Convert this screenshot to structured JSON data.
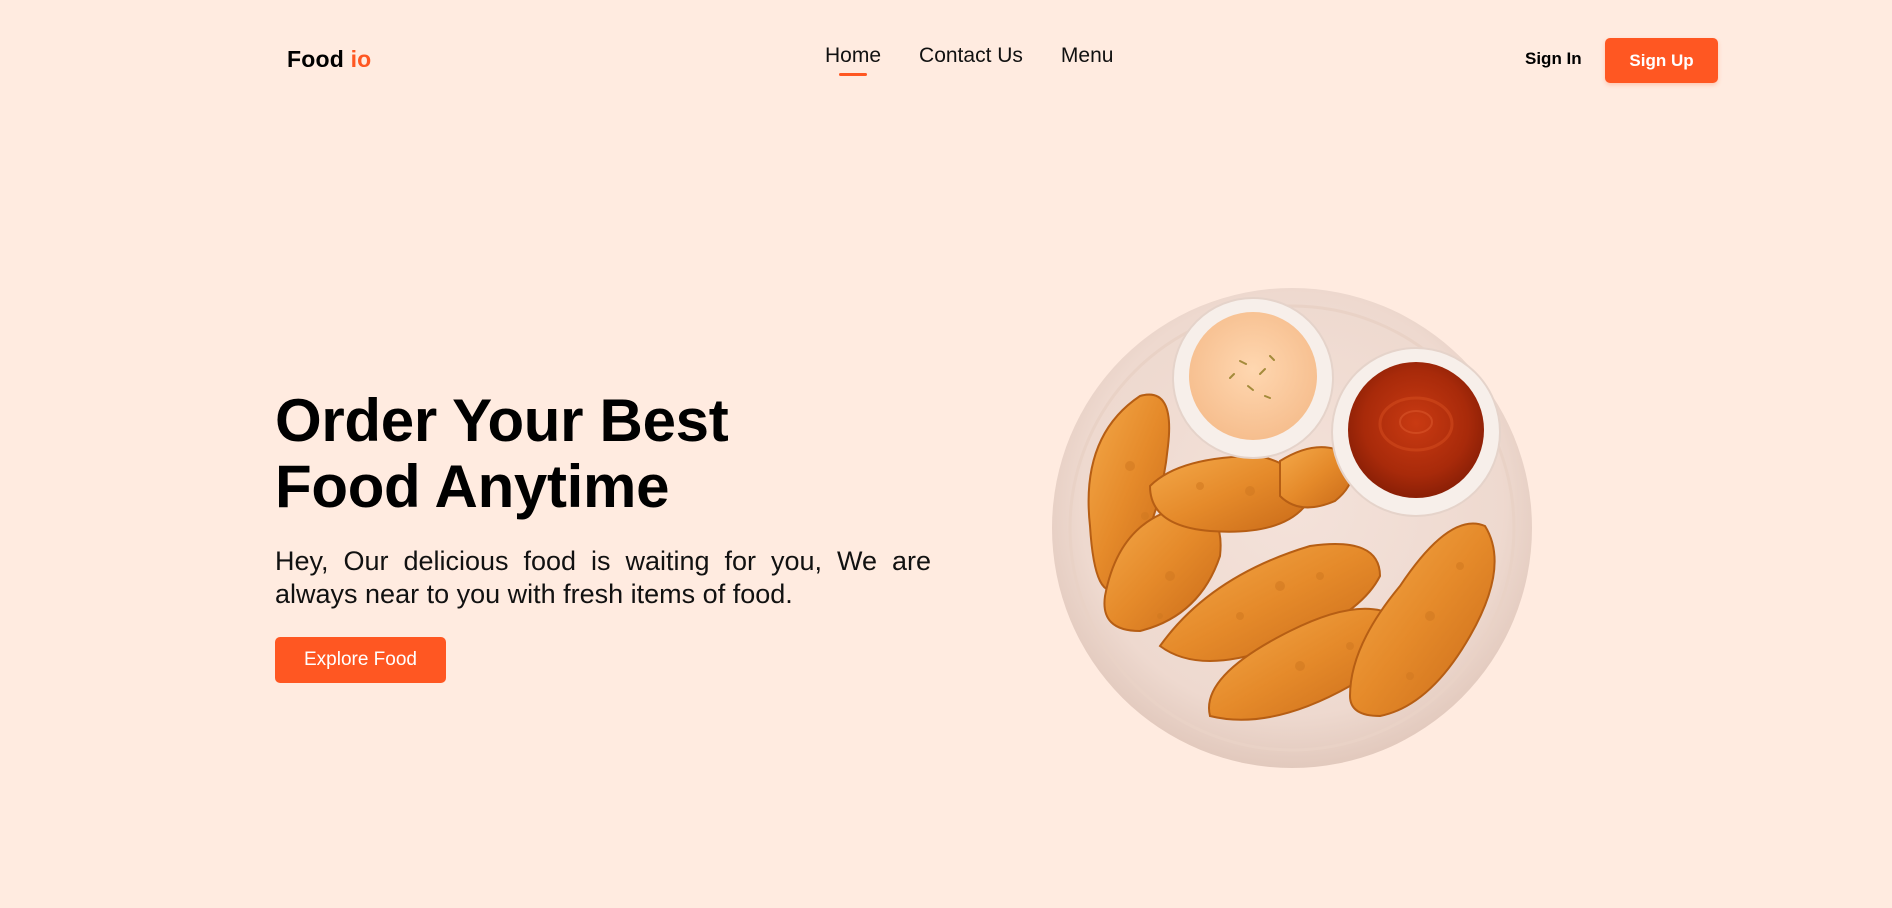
{
  "brand": {
    "name": "Food",
    "accent": "io",
    "accent_color": "#FF5722"
  },
  "nav": {
    "items": [
      {
        "label": "Home",
        "active": true
      },
      {
        "label": "Contact Us",
        "active": false
      },
      {
        "label": "Menu",
        "active": false
      }
    ]
  },
  "auth": {
    "signin_label": "Sign In",
    "signup_label": "Sign Up"
  },
  "hero": {
    "title_line1": "Order Your Best",
    "title_line2": "Food Anytime",
    "description": "Hey, Our delicious food is waiting for you, We are always near to you with fresh items of food.",
    "cta_label": "Explore Food",
    "image": "fried-chicken-plate-with-sauces"
  },
  "colors": {
    "background": "#FFEBE0",
    "accent": "#FF5722",
    "text": "#000000"
  }
}
